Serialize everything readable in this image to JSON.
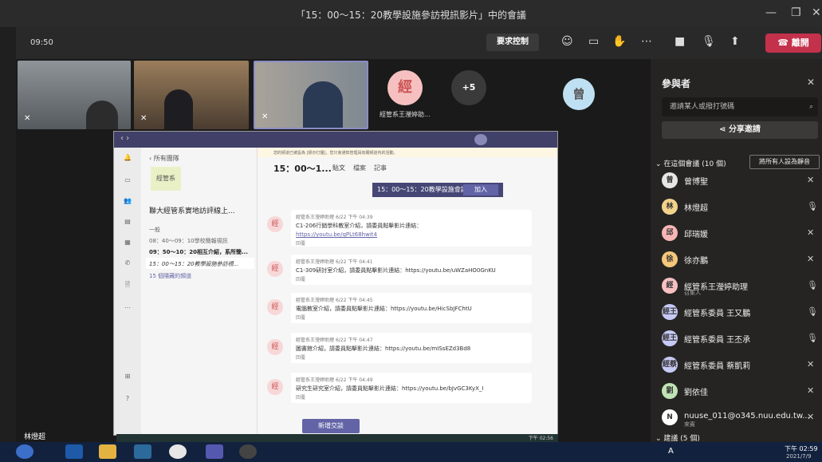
{
  "window": {
    "title": "「15：00～15：20教學設施參訪視訊影片」中的會議",
    "minimize": "—",
    "restore": "❐",
    "close": "✕"
  },
  "toolbar": {
    "time": "09:50",
    "request_control": "要求控制",
    "leave": "離開"
  },
  "stage": {
    "tile_caption": "經管系王瀅婷助...",
    "avatar1": "經",
    "more": "+5",
    "avatar2": "曾",
    "self_name": "林燈超"
  },
  "teams": {
    "back": "所有團隊",
    "team_badge": "經管系",
    "team_name": "聯大經管系實地訪評線上...",
    "channels": [
      "一般",
      "08：40～09：10學校簡報視訊",
      "09：50～10：20相互介紹，系所簡...",
      "15：00～15：20教學設施參訪視...",
      "15 個隱藏的頻道"
    ],
    "channel_title": "15：00～1...",
    "tabs": [
      "貼文",
      "檔案",
      "記事"
    ],
    "banner": "您的頻道已被設為 [標示打擾]，您只會通知管理員有關頻道內的活動。",
    "join_tip": "15：00～15：20教學設施會議...",
    "join": "加入",
    "messages": [
      {
        "author": "經管系王瀅婷助理",
        "time": "6/22 下午 04:39",
        "text": "C1-206行銷學科教室介紹，請委員點擊影片連結：",
        "link": "https://youtu.be/qPLt68hwit4",
        "reply": "回覆"
      },
      {
        "author": "經管系王瀅婷助理",
        "time": "6/22 下午 04:41",
        "text": "C1-309研討室介紹，請委員點擊影片連結：https://youtu.be/uWZaHO0GnKU",
        "reply": "回覆"
      },
      {
        "author": "經管系王瀅婷助理",
        "time": "6/22 下午 04:45",
        "text": "電腦教室介紹，請委員點擊影片連結：https://youtu.be/HicSbJFChtU",
        "reply": "回覆"
      },
      {
        "author": "經管系王瀅婷助理",
        "time": "6/22 下午 04:47",
        "text": "圖書館介紹，請委員點擊影片連結：https://youtu.be/mISsEZd3Bd8",
        "reply": "回覆"
      },
      {
        "author": "經管系王瀅婷助理",
        "time": "6/22 下午 04:49",
        "text": "研究生研究室介紹，請委員點擊影片連結：https://youtu.be/bJvGC3KyX_I",
        "reply": "回覆"
      }
    ],
    "new_conversation": "新增交談",
    "inner_clock": "下午 02:56"
  },
  "participants": {
    "heading": "參與者",
    "invite_placeholder": "邀請某人或撥打號碼",
    "share": "分享邀請",
    "in_meeting": "在這個會議 (10 個)",
    "mute_all": "將所有人設為靜音",
    "people": [
      {
        "initial": "曾",
        "name": "曾博聖",
        "color": "#e6e6e6",
        "mic": "muted"
      },
      {
        "initial": "林",
        "name": "林燈超",
        "color": "#f2d38c",
        "mic": "on"
      },
      {
        "initial": "邱",
        "name": "邱瑞媛",
        "color": "#f7b6b6",
        "mic": "muted"
      },
      {
        "initial": "徐",
        "name": "徐亦鵬",
        "color": "#f5c77a",
        "mic": "muted"
      },
      {
        "initial": "經",
        "name": "經管系王瀅婷助理",
        "sub": "召集人",
        "color": "#f7c0c0",
        "mic": "on"
      },
      {
        "initial": "經王",
        "name": "經管系委員 王又鵬",
        "color": "#c7c9f5",
        "mic": "on"
      },
      {
        "initial": "經王",
        "name": "經管系委員 王丕承",
        "color": "#c7c9f5",
        "mic": "on"
      },
      {
        "initial": "經蔡",
        "name": "經管系委員 蔡凱莉",
        "color": "#c7c9f5",
        "mic": "muted"
      },
      {
        "initial": "劉",
        "name": "劉依佳",
        "color": "#bfe3b4",
        "mic": "muted"
      },
      {
        "initial": "N",
        "name": "nuuse_011@o345.nuu.edu.tw...",
        "sub": "來賓",
        "color": "#ffffff",
        "mic": "muted"
      }
    ],
    "suggested": "建議 (5 個)"
  },
  "taskbar": {
    "time": "下午 02:59",
    "date": "2021/7/9",
    "ime": "A"
  }
}
